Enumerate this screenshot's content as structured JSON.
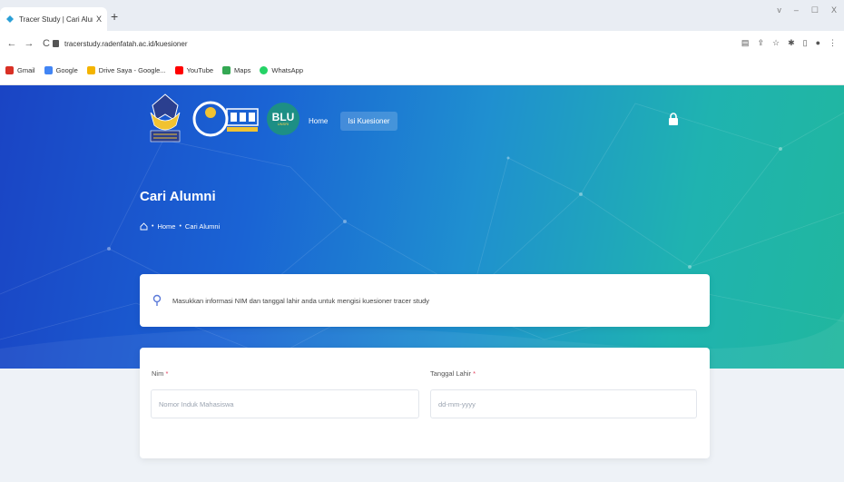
{
  "browser": {
    "tab_title": "Tracer Study | Cari Alumni",
    "tab_close": "X",
    "new_tab": "+",
    "url": "tracerstudy.radenfatah.ac.id/kuesioner",
    "window_controls": [
      "v",
      "–",
      "☐",
      "X"
    ],
    "bookmarks": [
      {
        "label": "Gmail",
        "color": "#d93025"
      },
      {
        "label": "Google",
        "color": "#4285f4"
      },
      {
        "label": "Drive Saya - Google...",
        "color": "#f4b400"
      },
      {
        "label": "YouTube",
        "color": "#ff0000"
      },
      {
        "label": "Maps",
        "color": "#34a853"
      },
      {
        "label": "WhatsApp",
        "color": "#25d366"
      }
    ]
  },
  "header": {
    "blu_text": "BLU",
    "blu_sub": "UNSRI",
    "nav": [
      {
        "label": "Home",
        "active": false
      },
      {
        "label": "Isi Kuesioner",
        "active": true
      }
    ]
  },
  "hero": {
    "title": "Cari Alumni",
    "breadcrumb": [
      "Home",
      "Cari Alumni"
    ]
  },
  "info": {
    "message": "Masukkan informasi NIM dan tanggal lahir anda untuk mengisi kuesioner tracer study"
  },
  "form": {
    "nim_label": "Nim",
    "nim_placeholder": "Nomor Induk Mahasiswa",
    "dob_label": "Tanggal Lahir",
    "dob_placeholder": "dd-mm-yyyy",
    "required_mark": "*"
  },
  "colors": {
    "hero_start": "#1a44c4",
    "hero_end": "#21b79e",
    "required": "#e2425f"
  }
}
